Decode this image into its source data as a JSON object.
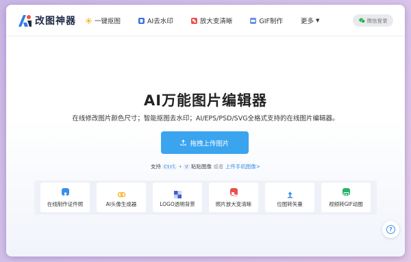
{
  "brand": {
    "name": "改图神器"
  },
  "nav": {
    "items": [
      {
        "label": "一键抠图",
        "icon": "sparkle-icon"
      },
      {
        "label": "AI去水印",
        "icon": "ai-icon"
      },
      {
        "label": "放大变清晰",
        "icon": "enlarge-icon"
      },
      {
        "label": "GIF制作",
        "icon": "gif-icon"
      },
      {
        "label": "更多",
        "icon": "chevron-down-icon"
      }
    ]
  },
  "login": {
    "label": "微信登录",
    "icon": "wechat-icon"
  },
  "hero": {
    "title": "AI万能图片编辑器",
    "subtitle": "在线修改图片颜色尺寸；智能抠图去水印；AI/EPS/PSD/SVG全格式支持的在线图片编辑器。",
    "upload_label": "拖拽上传图片",
    "paste": {
      "prefix": "支持",
      "key1": "Ctrl",
      "plus": "+",
      "key2": "V",
      "action": "粘贴图像",
      "or": "或者",
      "mobile_link": "上传手机图像>"
    }
  },
  "tools": [
    {
      "label": "在线制作证件照",
      "icon": "id-photo-icon",
      "color": "#3b8ee8"
    },
    {
      "label": "AI头像生成器",
      "icon": "avatar-gen-icon",
      "color": "#f5b52a"
    },
    {
      "label": "LOGO透明背景",
      "icon": "transparent-icon",
      "color": "#3f5ec9"
    },
    {
      "label": "照片放大变清晰",
      "icon": "photo-enlarge-icon",
      "color": "#e8514a"
    },
    {
      "label": "位图转矢量",
      "icon": "vector-icon",
      "color": "#3b8ee8"
    },
    {
      "label": "视频转GIF动图",
      "icon": "video-gif-icon",
      "color": "#27b36a"
    }
  ],
  "colors": {
    "accent": "#3ba4ee",
    "link": "#3b8ee8"
  }
}
